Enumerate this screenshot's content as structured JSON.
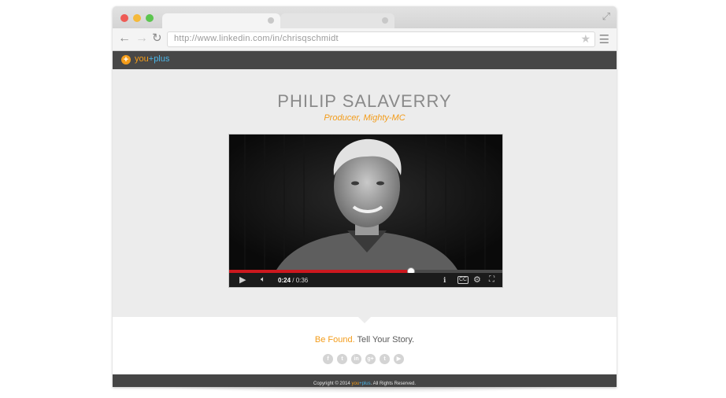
{
  "browser": {
    "url": "http://www.linkedin.com/in/chrisqschmidt",
    "icons": {
      "back": "arrow-left-icon",
      "forward": "arrow-right-icon",
      "reload": "reload-icon",
      "bookmark": "star-icon",
      "menu": "hamburger-menu-icon",
      "expand": "expand-icon"
    }
  },
  "app": {
    "logo_you": "you",
    "logo_plus_sign": "+",
    "logo_plus": "plus"
  },
  "hero": {
    "name": "PHILIP SALAVERRY",
    "role": "Producer, Mighty-MC"
  },
  "video": {
    "current_time": "0:24",
    "duration": "0:36",
    "time_separator": " / ",
    "progress": 0.667
  },
  "footer": {
    "tagline_accent": "Be Found.",
    "tagline_rest": " Tell Your Story.",
    "social": [
      {
        "name": "facebook-icon",
        "glyph": "f"
      },
      {
        "name": "twitter-icon",
        "glyph": "t"
      },
      {
        "name": "linkedin-icon",
        "glyph": "in"
      },
      {
        "name": "google-plus-icon",
        "glyph": "g+"
      },
      {
        "name": "tumblr-icon",
        "glyph": "t"
      },
      {
        "name": "youtube-icon",
        "glyph": "▶"
      }
    ],
    "copyright_prefix": "Copyright © 2014 ",
    "copyright_you": "you",
    "copyright_plus_sign": "+",
    "copyright_plus": "plus",
    "copyright_suffix": ". All Rights Reserved."
  },
  "colors": {
    "accent": "#f39c1a",
    "brand_blue": "#4cb6e8",
    "progress_red": "#cc181e",
    "header_dark": "#474747"
  }
}
